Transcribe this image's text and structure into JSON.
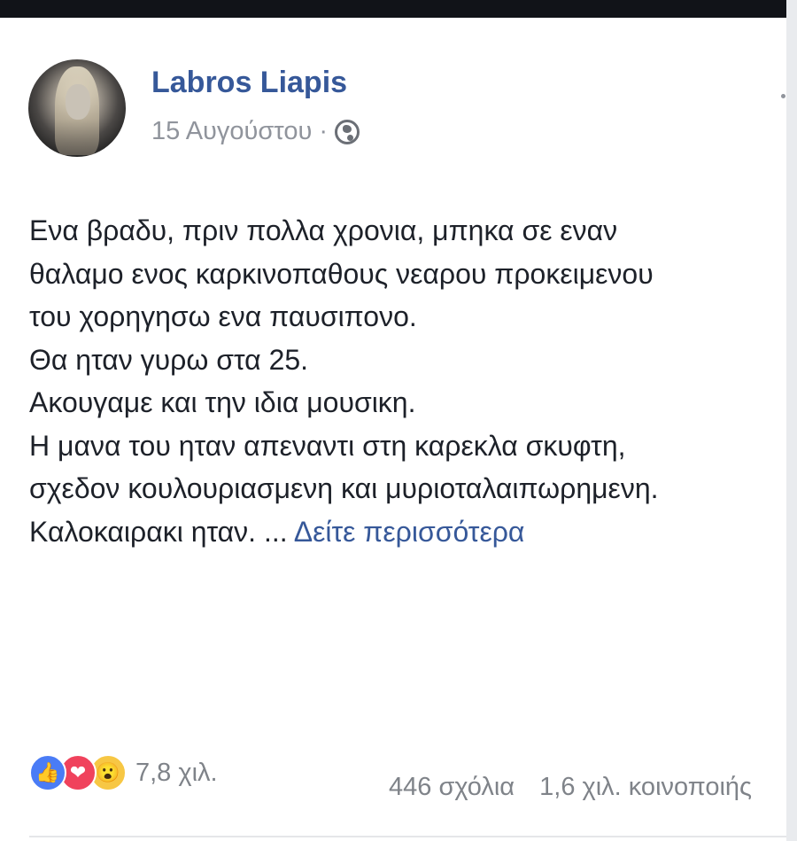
{
  "post": {
    "author": "Labros Liapis",
    "date": "15 Αυγούστου",
    "separator": "·",
    "privacy_icon": "globe-icon",
    "text_lines": [
      "Ενα βραδυ, πριν πολλα χρονια, μπηκα σε εναν",
      "θαλαμο ενος καρκινοπαθους νεαρου προκειμενου",
      "του χορηγησω ενα παυσιπονο.",
      "Θα ηταν γυρω στα 25.",
      "Ακουγαμε και την ιδια μουσικη.",
      "Η μανα του ηταν απεναντι στη καρεκλα σκυφτη,",
      "σχεδον κουλουριασμενη και μυριοταλαιπωρημενη.",
      "Καλοκαιρακι ηταν. ..."
    ],
    "see_more": "Δείτε περισσότερα"
  },
  "stats": {
    "reaction_icons": [
      "like-icon",
      "love-icon",
      "wow-icon"
    ],
    "reactions_count": "7,8 χιλ.",
    "comments": "446 σχόλια",
    "shares": "1,6 χιλ. κοινοποιής"
  },
  "colors": {
    "author": "#365899",
    "text": "#1d2129",
    "meta": "#90949c",
    "topbar": "#111318"
  }
}
